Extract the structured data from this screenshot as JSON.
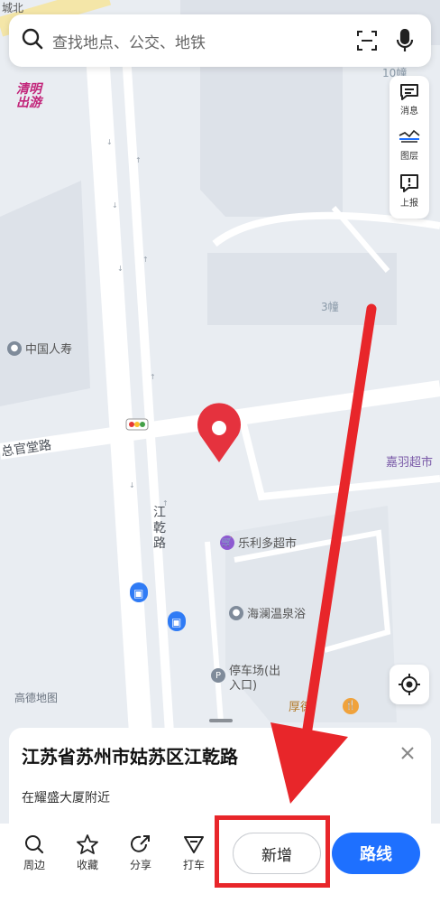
{
  "map": {
    "road_top_label": "城北",
    "promo_badge": "清明出游",
    "building_10": "10幢",
    "building_3": "3幢",
    "street_west": "总官堂路",
    "street_jiangqian": "江乾路",
    "poi_insurance": "中国人寿",
    "poi_supermarket": "乐利多超市",
    "poi_bath": "海澜温泉浴",
    "poi_parking": "停车场(出入口)",
    "poi_houde": "厚德",
    "poi_jiayu": "嘉羽超市",
    "map_brand": "高德地图"
  },
  "search": {
    "placeholder": "查找地点、公交、地铁",
    "scan_icon": "scan-icon",
    "mic_icon": "microphone-icon"
  },
  "side_panel": {
    "items": [
      {
        "label": "消息",
        "icon": "message-icon"
      },
      {
        "label": "图层",
        "icon": "layers-icon"
      },
      {
        "label": "上报",
        "icon": "report-icon"
      }
    ]
  },
  "place_sheet": {
    "title": "江苏省苏州市姑苏区江乾路",
    "subtitle": "在耀盛大厦附近"
  },
  "bottom_actions": {
    "items": [
      {
        "label": "周边",
        "icon": "search-nearby-icon"
      },
      {
        "label": "收藏",
        "icon": "star-icon"
      },
      {
        "label": "分享",
        "icon": "share-icon"
      },
      {
        "label": "打车",
        "icon": "taxi-icon"
      }
    ],
    "add_label": "新增",
    "route_label": "路线"
  },
  "colors": {
    "accent_blue": "#1e70ff",
    "annotation_red": "#e8262a",
    "pin_red": "#e5323e",
    "map_bg": "#e9edf2",
    "road": "#ffffff"
  }
}
